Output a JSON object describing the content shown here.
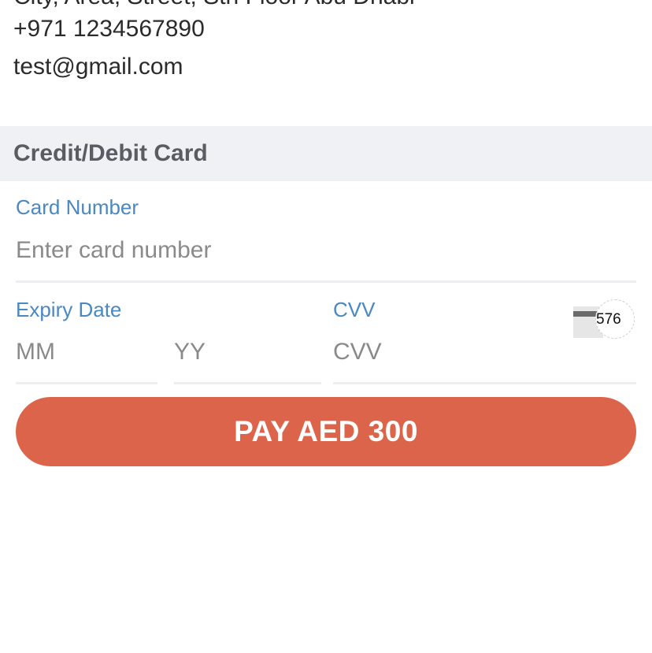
{
  "contact": {
    "cut_line": "City, Area, Street, Sth Floor Abu Dhabi",
    "phone": "+971 1234567890",
    "email": "test@gmail.com"
  },
  "payment_section": {
    "title": "Credit/Debit Card"
  },
  "card_number": {
    "label": "Card Number",
    "placeholder": "Enter card number",
    "value": ""
  },
  "expiry": {
    "label": "Expiry Date",
    "month_placeholder": "MM",
    "year_placeholder": "YY"
  },
  "cvv": {
    "label": "CVV",
    "placeholder": "CVV",
    "hint_digits": "576",
    "icon": "card-cvv-icon"
  },
  "pay_button": {
    "label": "PAY AED 300",
    "color": "#dc644a"
  },
  "colors": {
    "label_blue": "#4a88c2",
    "section_bg": "#f0f1f5",
    "accent": "#dc644a"
  }
}
